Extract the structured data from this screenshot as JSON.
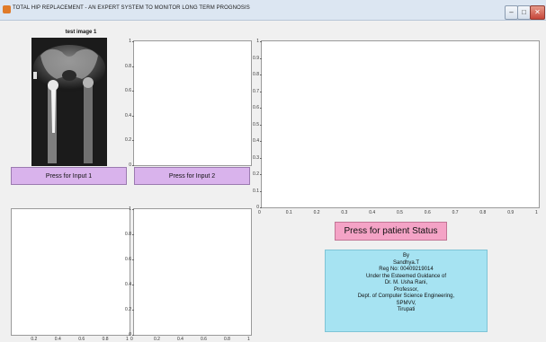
{
  "window": {
    "title": "TOTAL HIP REPLACEMENT - AN EXPERT SYSTEM TO MONITOR LONG TERM PROGNOSIS",
    "controls": {
      "minimize": "–",
      "maximize": "□",
      "close": "✕"
    }
  },
  "image_panel": {
    "title": "test image 1"
  },
  "buttons": {
    "input1": "Press for Input 1",
    "input2": "Press for Input 2",
    "status": "Press for patient Status"
  },
  "axes_ticks": {
    "y_small": [
      "1",
      "0.8",
      "0.6",
      "0.4",
      "0.2",
      "0"
    ],
    "y_big": [
      "1",
      "0.9",
      "0.8",
      "0.7",
      "0.6",
      "0.5",
      "0.4",
      "0.3",
      "0.2",
      "0.1",
      "0"
    ],
    "x_big": [
      "0",
      "0.1",
      "0.2",
      "0.3",
      "0.4",
      "0.5",
      "0.6",
      "0.7",
      "0.8",
      "0.9",
      "1"
    ],
    "x_small": [
      "0.2",
      "0.4",
      "0.6",
      "0.8",
      "1"
    ],
    "x_small_right": [
      "0",
      "0.2",
      "0.4",
      "0.6",
      "0.8",
      "1"
    ]
  },
  "credits": [
    "By",
    "Sandhya.T",
    "Reg No: 00409219014",
    "",
    "Under the Esteemed Guidance  of",
    "Dr. M. Usha Rani,",
    "Professor,",
    "Dept. of Computer Science Engineering,",
    "SPMVV,",
    "Tirupati"
  ],
  "colors": {
    "input_button": "#d9b3ec",
    "status_button": "#f4a3c6",
    "credits_panel": "#a6e3f2"
  }
}
